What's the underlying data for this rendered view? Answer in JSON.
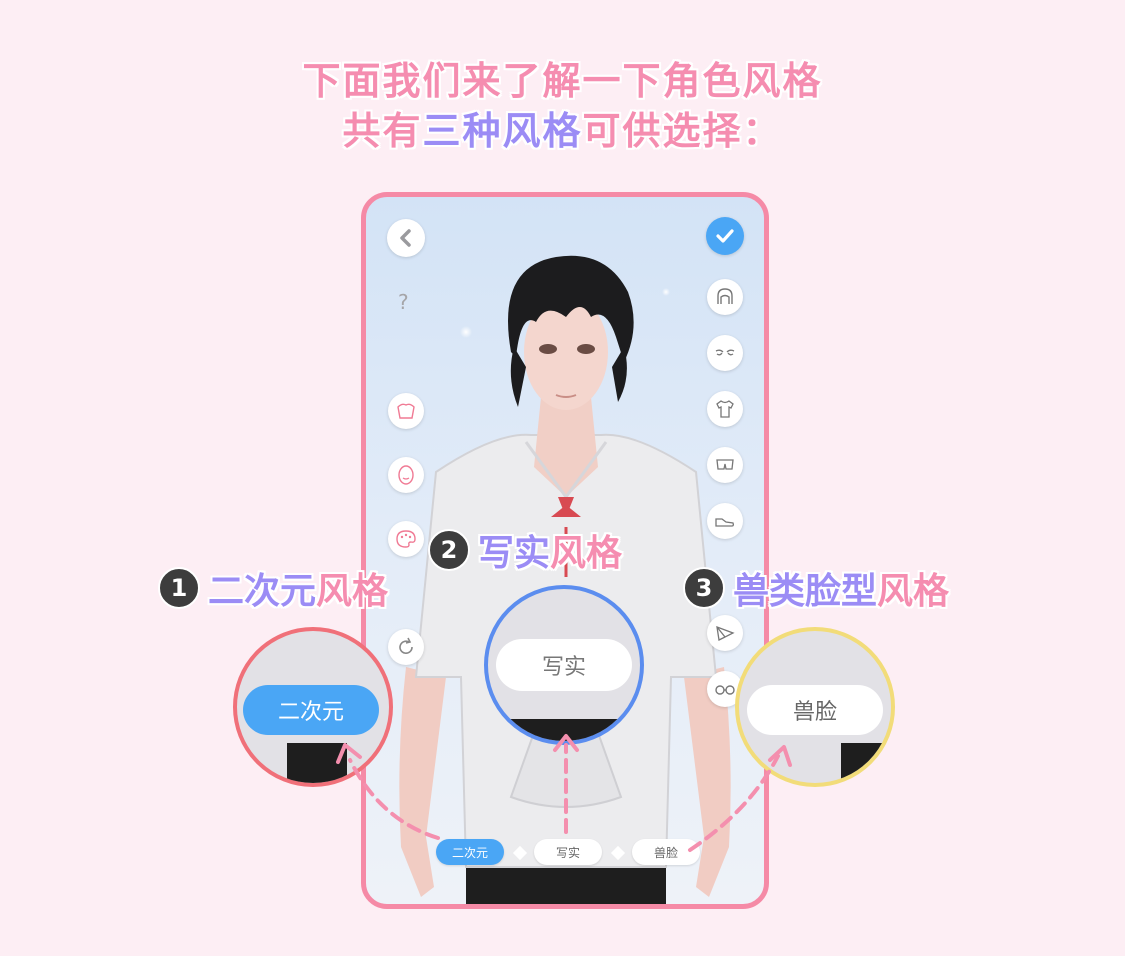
{
  "intro": {
    "line1": "下面我们来了解一下角色风格",
    "line2_a": "共有",
    "line2_b": "三种风格",
    "line2_c": "可供选择："
  },
  "phone": {
    "left_icons": [
      "back-icon",
      "help-icon",
      "body-icon",
      "face-icon",
      "palette-icon",
      "reset-icon"
    ],
    "right_icons": [
      "confirm-icon",
      "hair-icon",
      "eyes-icon",
      "shirt-icon",
      "pants-icon",
      "shoes-icon",
      "fan-icon",
      "glasses-icon"
    ],
    "tabs": [
      "二次元",
      "写实",
      "兽脸"
    ],
    "active_tab": "二次元",
    "help_text": "?"
  },
  "callouts": [
    {
      "num": "1",
      "part1": "二次元",
      "part2": "风格",
      "zoom_label": "二次元",
      "ring_color": "#f07079"
    },
    {
      "num": "2",
      "part1": "写实",
      "part2": "风格",
      "zoom_label": "写实",
      "ring_color": "#5b8def"
    },
    {
      "num": "3",
      "part1": "兽类脸型",
      "part2": "风格",
      "zoom_label": "兽脸",
      "ring_color": "#f2dc79"
    }
  ],
  "colors": {
    "accent_pink": "#f58db0",
    "accent_purple": "#9b8cf5",
    "active_blue": "#4aa6f5",
    "frame_pink": "#f58aa6"
  }
}
